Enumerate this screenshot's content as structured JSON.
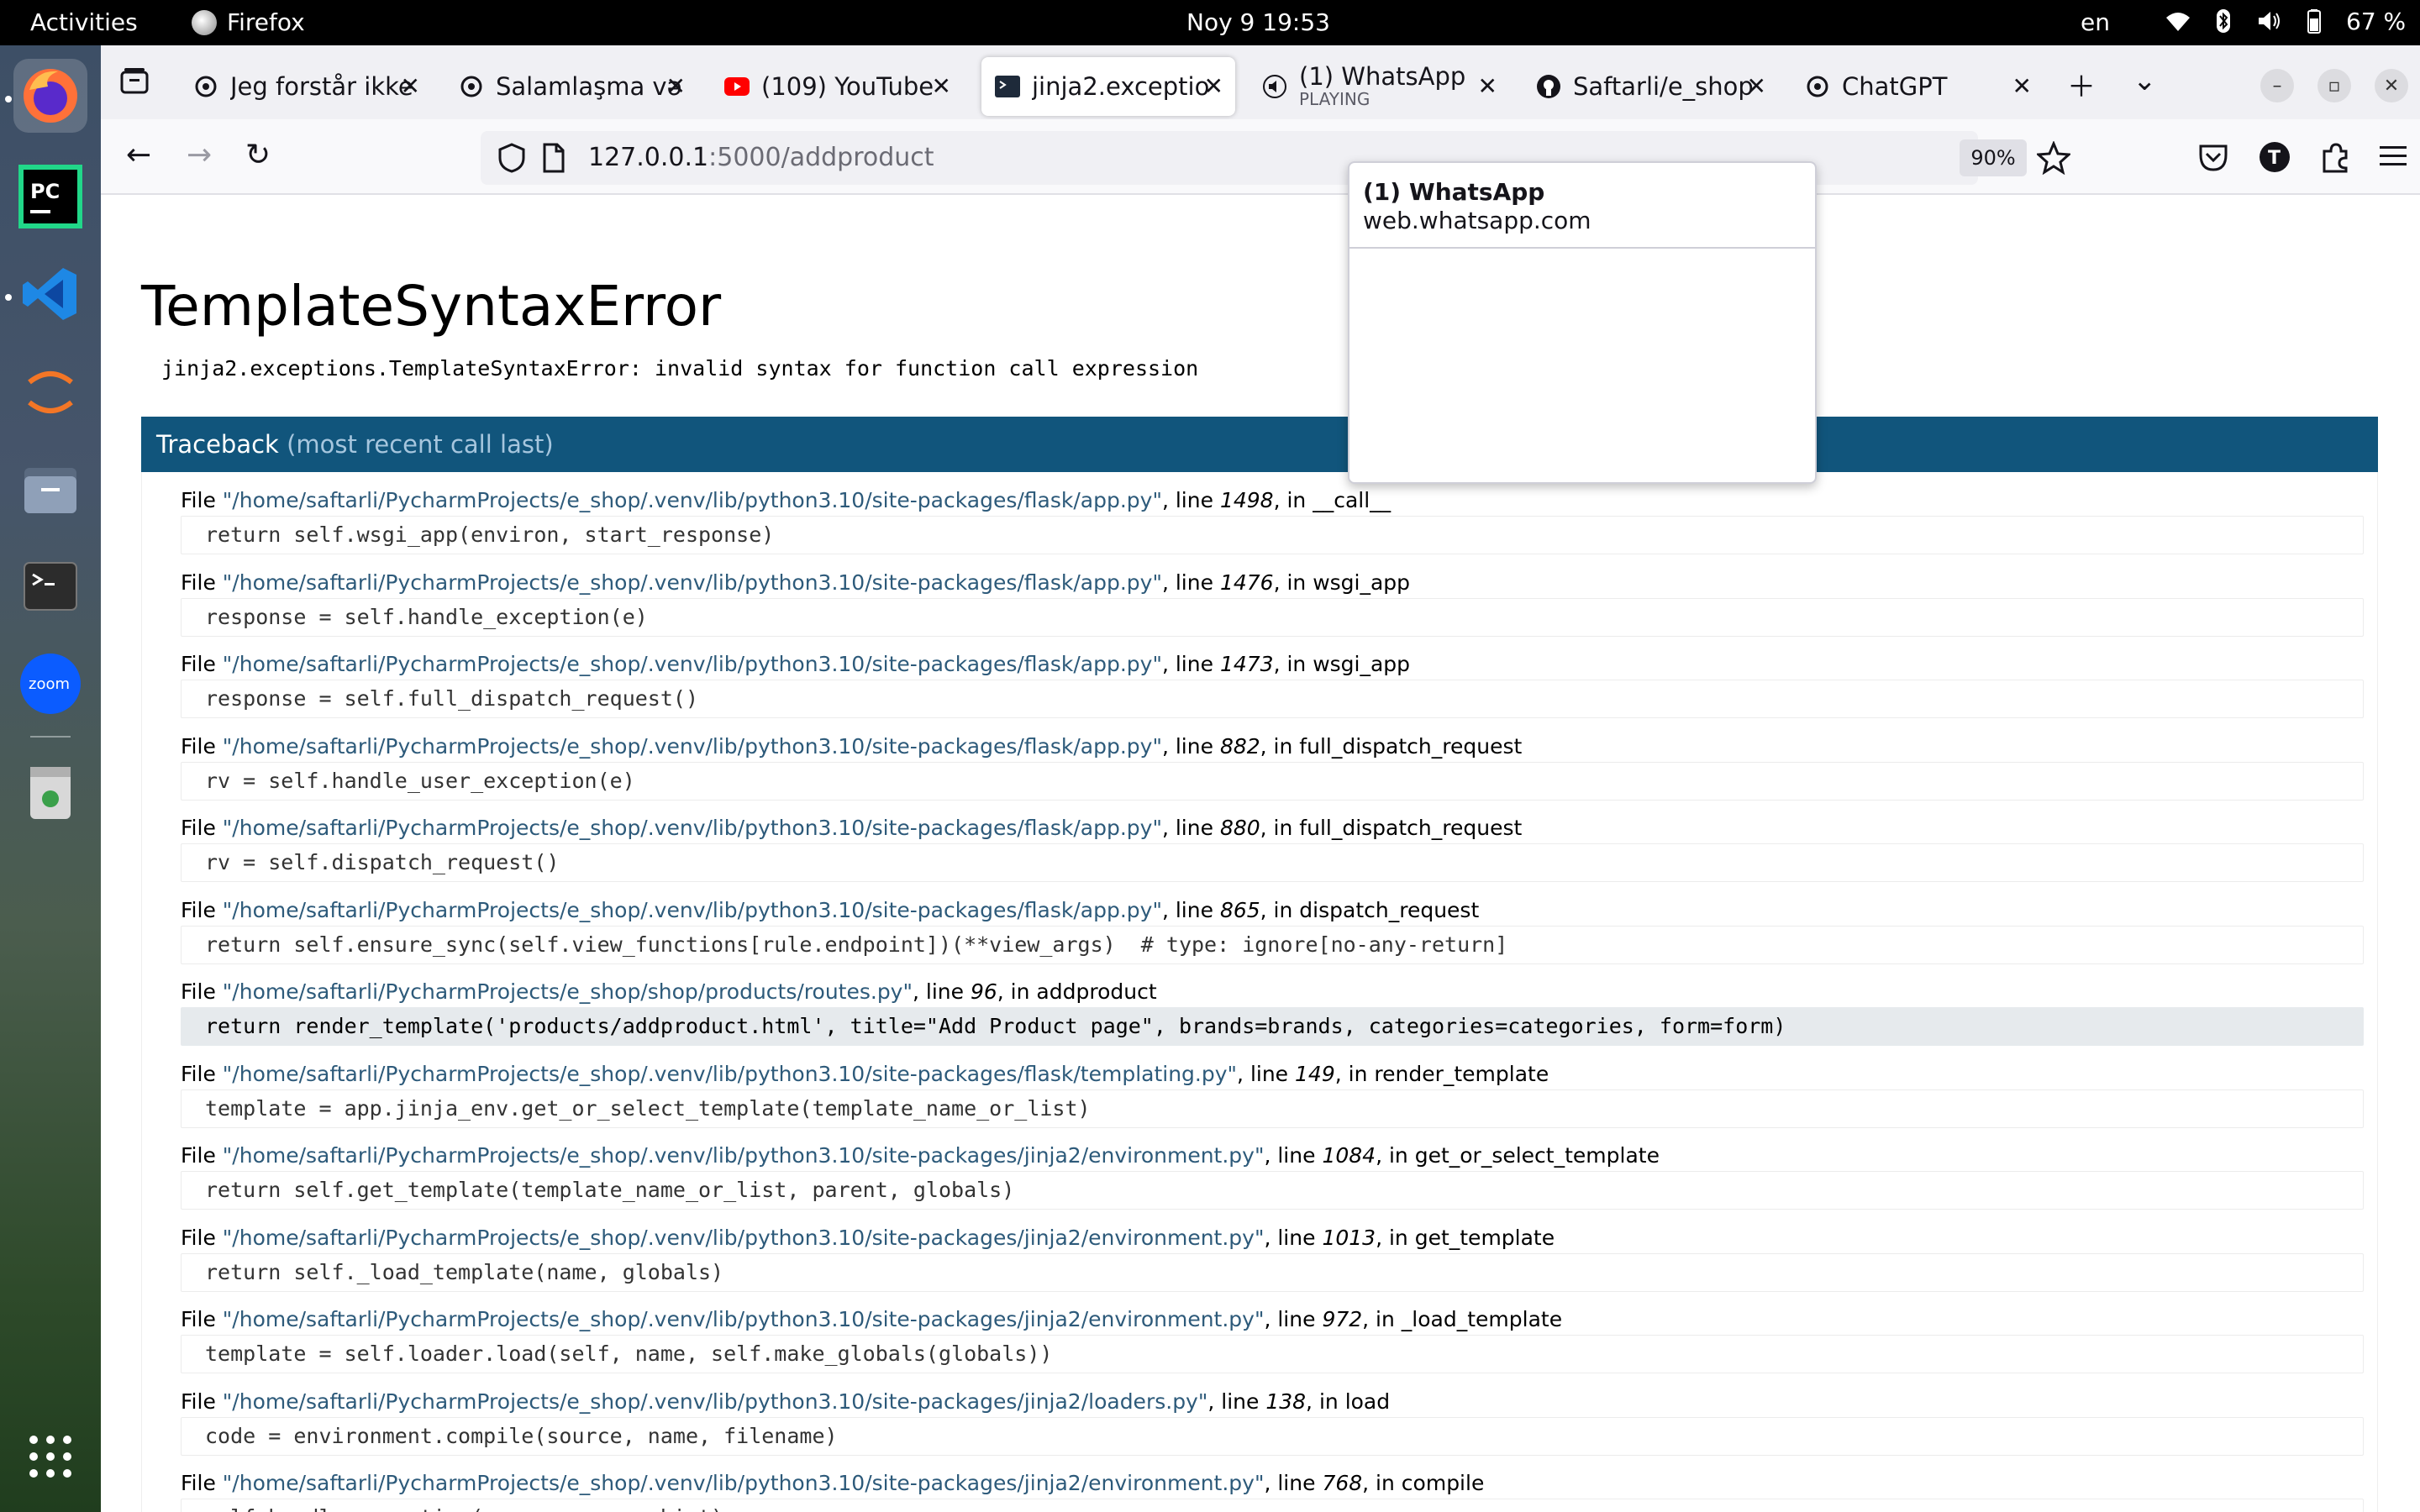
{
  "topbar": {
    "activities": "Activities",
    "app_name": "Firefox",
    "clock": "Noy 9  19:53",
    "lang": "en",
    "battery": "67 %"
  },
  "dock": {
    "items": [
      "firefox-icon",
      "pycharm-icon",
      "vscode-icon",
      "jupyter-icon",
      "files-icon",
      "terminal-icon",
      "zoom-icon",
      "trash-icon",
      "app-grid-icon"
    ],
    "zoom_label": "zoom",
    "pycharm_label": "PC"
  },
  "tabs": [
    {
      "title": "Jeg forstår ikke",
      "icon": "chatgpt-icon"
    },
    {
      "title": "Salamlaşma və",
      "icon": "chatgpt-icon"
    },
    {
      "title": "(109) YouTube",
      "icon": "youtube-icon"
    },
    {
      "title": "jinja2.exceptio",
      "icon": "terminal-icon",
      "active": true
    },
    {
      "title": "(1) WhatsApp",
      "subtitle": "PLAYING",
      "icon": "speaker-icon"
    },
    {
      "title": "Saftarli/e_shop",
      "icon": "github-icon"
    },
    {
      "title": "ChatGPT",
      "icon": "chatgpt-icon"
    }
  ],
  "navbar": {
    "url_host": "127.0.0.1",
    "url_rest": ":5000/addproduct",
    "zoom": "90%"
  },
  "popup": {
    "title": "(1) WhatsApp",
    "url": "web.whatsapp.com"
  },
  "error": {
    "title": "TemplateSyntaxError",
    "message": "jinja2.exceptions.TemplateSyntaxError: invalid syntax for function call expression",
    "traceback_label": "Traceback",
    "traceback_note": "(most recent call last)"
  },
  "frames": [
    {
      "file": "\"/home/saftarli/PycharmProjects/e_shop/.venv/lib/python3.10/site-packages/flask/app.py\"",
      "line": "1498",
      "func": "__call__",
      "code": "return self.wsgi_app(environ, start_response)"
    },
    {
      "file": "\"/home/saftarli/PycharmProjects/e_shop/.venv/lib/python3.10/site-packages/flask/app.py\"",
      "line": "1476",
      "func": "wsgi_app",
      "code": "response = self.handle_exception(e)"
    },
    {
      "file": "\"/home/saftarli/PycharmProjects/e_shop/.venv/lib/python3.10/site-packages/flask/app.py\"",
      "line": "1473",
      "func": "wsgi_app",
      "code": "response = self.full_dispatch_request()"
    },
    {
      "file": "\"/home/saftarli/PycharmProjects/e_shop/.venv/lib/python3.10/site-packages/flask/app.py\"",
      "line": "882",
      "func": "full_dispatch_request",
      "code": "rv = self.handle_user_exception(e)"
    },
    {
      "file": "\"/home/saftarli/PycharmProjects/e_shop/.venv/lib/python3.10/site-packages/flask/app.py\"",
      "line": "880",
      "func": "full_dispatch_request",
      "code": "rv = self.dispatch_request()"
    },
    {
      "file": "\"/home/saftarli/PycharmProjects/e_shop/.venv/lib/python3.10/site-packages/flask/app.py\"",
      "line": "865",
      "func": "dispatch_request",
      "code": "return self.ensure_sync(self.view_functions[rule.endpoint])(**view_args)  # type: ignore[no-any-return]"
    },
    {
      "file": "\"/home/saftarli/PycharmProjects/e_shop/shop/products/routes.py\"",
      "line": "96",
      "func": "addproduct",
      "code": "return render_template('products/addproduct.html', title=\"Add Product page\", brands=brands, categories=categories, form=form)",
      "current": true
    },
    {
      "file": "\"/home/saftarli/PycharmProjects/e_shop/.venv/lib/python3.10/site-packages/flask/templating.py\"",
      "line": "149",
      "func": "render_template",
      "code": "template = app.jinja_env.get_or_select_template(template_name_or_list)"
    },
    {
      "file": "\"/home/saftarli/PycharmProjects/e_shop/.venv/lib/python3.10/site-packages/jinja2/environment.py\"",
      "line": "1084",
      "func": "get_or_select_template",
      "code": "return self.get_template(template_name_or_list, parent, globals)"
    },
    {
      "file": "\"/home/saftarli/PycharmProjects/e_shop/.venv/lib/python3.10/site-packages/jinja2/environment.py\"",
      "line": "1013",
      "func": "get_template",
      "code": "return self._load_template(name, globals)"
    },
    {
      "file": "\"/home/saftarli/PycharmProjects/e_shop/.venv/lib/python3.10/site-packages/jinja2/environment.py\"",
      "line": "972",
      "func": "_load_template",
      "code": "template = self.loader.load(self, name, self.make_globals(globals))"
    },
    {
      "file": "\"/home/saftarli/PycharmProjects/e_shop/.venv/lib/python3.10/site-packages/jinja2/loaders.py\"",
      "line": "138",
      "func": "load",
      "code": "code = environment.compile(source, name, filename)"
    },
    {
      "file": "\"/home/saftarli/PycharmProjects/e_shop/.venv/lib/python3.10/site-packages/jinja2/environment.py\"",
      "line": "768",
      "func": "compile",
      "code": "self.handle_exception(source=source_hint)"
    }
  ],
  "labels": {
    "file_word": "File",
    "line_word": ", line ",
    "in_word": ", in "
  },
  "colors": {
    "traceback_header": "#11557c",
    "path_link": "#2d5a7a",
    "current_frame_bg": "#e6eaed"
  }
}
